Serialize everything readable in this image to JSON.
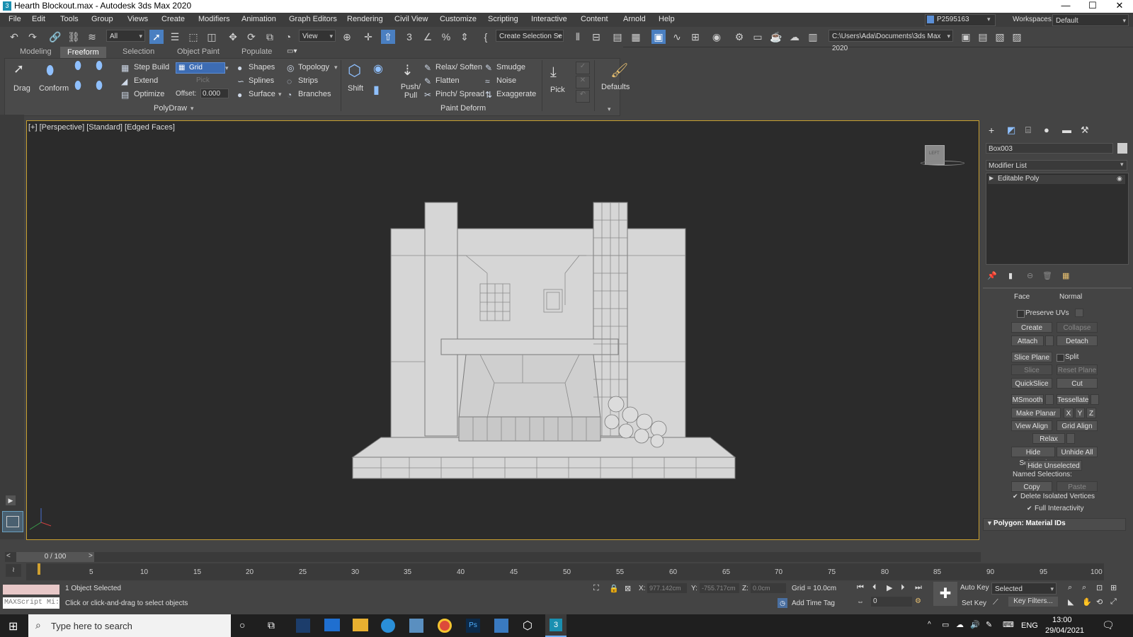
{
  "window": {
    "title": "Hearth Blockout.max - Autodesk 3ds Max 2020",
    "minimize": "—",
    "maximize": "☐",
    "close": "✕"
  },
  "menu": [
    "File",
    "Edit",
    "Tools",
    "Group",
    "Views",
    "Create",
    "Modifiers",
    "Animation",
    "Graph Editors",
    "Rendering",
    "Civil View",
    "Customize",
    "Scripting",
    "Interactive",
    "Content",
    "Arnold",
    "Help"
  ],
  "user": "P2595163",
  "workspaces": {
    "label": "Workspaces:",
    "value": "Default"
  },
  "toolbar": {
    "filter": "All",
    "ref_coord": "View",
    "selection_set": "Create Selection Se",
    "path": "C:\\Users\\Ada\\Documents\\3ds Max 2020"
  },
  "ribbon": {
    "tabs": [
      "Modeling",
      "Freeform",
      "Selection",
      "Object Paint",
      "Populate"
    ],
    "selected_tab": "Freeform",
    "drag": "Drag",
    "conform": "Conform",
    "step_build": "Step Build",
    "extend": "Extend",
    "optimize": "Optimize",
    "grid": "Grid",
    "pick": "Pick",
    "offset_label": "Offset:",
    "offset_value": "0.000",
    "shapes": "Shapes",
    "splines": "Splines",
    "surface": "Surface",
    "topology": "Topology",
    "strips": "Strips",
    "branches": "Branches",
    "polydraw": "PolyDraw",
    "shift": "Shift",
    "push_pull": "Push/ Pull",
    "relax_soften": "Relax/ Soften",
    "flatten": "Flatten",
    "pinch_spread": "Pinch/ Spread",
    "smudge": "Smudge",
    "noise": "Noise",
    "exaggerate": "Exaggerate",
    "pick2": "Pick",
    "paint_deform": "Paint Deform",
    "defaults": "Defaults"
  },
  "viewport": {
    "label": "[+] [Perspective] [Standard] [Edged Faces]",
    "viewcube": "LEFT"
  },
  "command_panel": {
    "object_name": "Box003",
    "modifier_list": "Modifier List",
    "stack_item": "Editable Poly",
    "face": "Face",
    "normal": "Normal",
    "preserve_uvs": "Preserve UVs",
    "create": "Create",
    "collapse": "Collapse",
    "attach": "Attach",
    "detach": "Detach",
    "slice_plane": "Slice Plane",
    "split": "Split",
    "slice": "Slice",
    "reset_plane": "Reset Plane",
    "quickslice": "QuickSlice",
    "cut": "Cut",
    "msmooth": "MSmooth",
    "tessellate": "Tessellate",
    "make_planar": "Make Planar",
    "x": "X",
    "y": "Y",
    "z": "Z",
    "view_align": "View Align",
    "grid_align": "Grid Align",
    "relax": "Relax",
    "hide_selected": "Hide Selected",
    "unhide_all": "Unhide All",
    "hide_unselected": "Hide Unselected",
    "named_selections": "Named Selections:",
    "copy": "Copy",
    "paste": "Paste",
    "delete_isolated": "Delete Isolated Vertices",
    "full_interactivity": "Full Interactivity",
    "rollout": "Polygon: Material IDs"
  },
  "timeline": {
    "frame": "0 / 100",
    "ticks": [
      "5",
      "10",
      "15",
      "20",
      "25",
      "30",
      "35",
      "40",
      "45",
      "50",
      "55",
      "60",
      "65",
      "70",
      "75",
      "80",
      "85",
      "90",
      "95",
      "100"
    ]
  },
  "status": {
    "maxscript": "MAXScript Mi:",
    "selected": "1 Object Selected",
    "prompt": "Click or click-and-drag to select objects",
    "x_label": "X:",
    "x_value": "977.142cm",
    "y_label": "Y:",
    "y_value": "-755.717cm",
    "z_label": "Z:",
    "z_value": "0.0cm",
    "grid": "Grid = 10.0cm",
    "add_time_tag": "Add Time Tag",
    "auto_key": "Auto Key",
    "set_key": "Set Key",
    "key_mode": "Selected",
    "key_filters": "Key Filters...",
    "frame_field": "0"
  },
  "taskbar": {
    "search_placeholder": "Type here to search",
    "lang": "ENG",
    "time": "13:00",
    "date": "29/04/2021"
  }
}
